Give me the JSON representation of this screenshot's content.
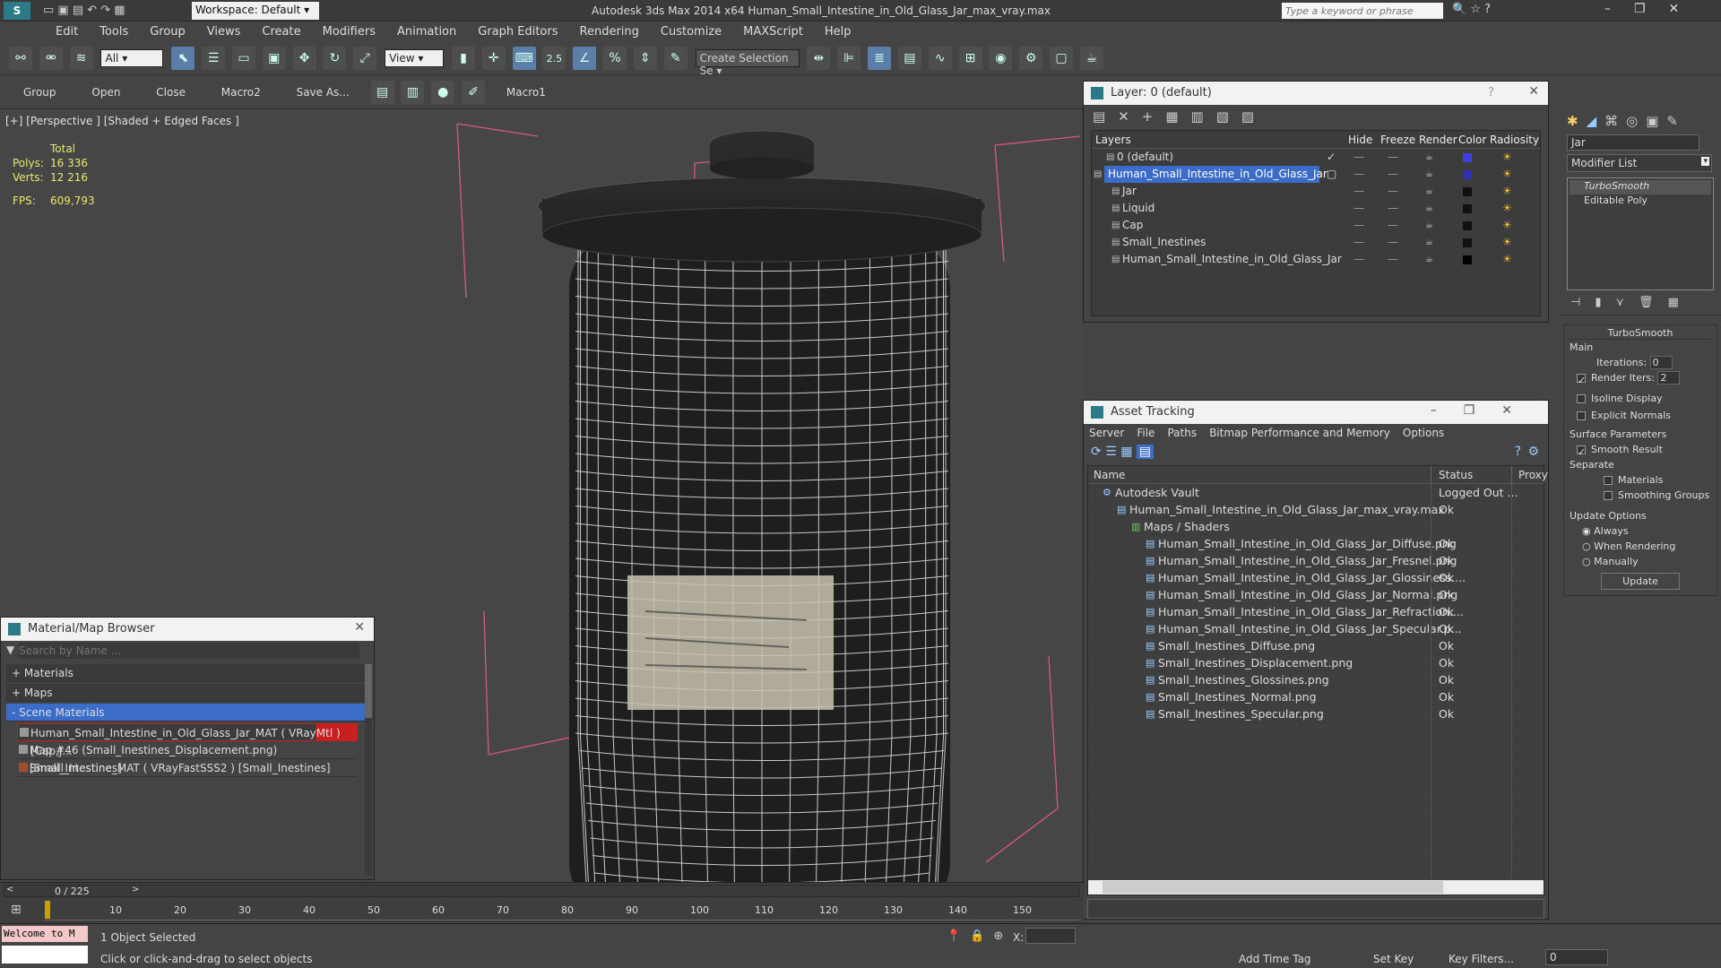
{
  "title_bar": {
    "workspace": "Workspace: Default",
    "app_title": "Autodesk 3ds Max  2014 x64     Human_Small_Intestine_in_Old_Glass_Jar_max_vray.max",
    "search_placeholder": "Type a keyword or phrase"
  },
  "menu": [
    "Edit",
    "Tools",
    "Group",
    "Views",
    "Create",
    "Modifiers",
    "Animation",
    "Graph Editors",
    "Rendering",
    "Customize",
    "MAXScript",
    "Help"
  ],
  "toolbar": {
    "filter": "All",
    "ref_coord": "View",
    "snap": "2.5",
    "selection_set": "Create Selection Se"
  },
  "ribbon": [
    "Group",
    "Open",
    "Close",
    "Macro2",
    "Save As...",
    "Macro1"
  ],
  "viewport": {
    "label": "[+] [Perspective ] [Shaded + Edged Faces ]",
    "stats_header": "Total",
    "polys_label": "Polys:",
    "polys": "16 336",
    "verts_label": "Verts:",
    "verts": "12 216",
    "fps_label": "FPS:",
    "fps": "609,793"
  },
  "layer_panel": {
    "title": "Layer: 0 (default)",
    "columns": [
      "Layers",
      "Hide",
      "Freeze",
      "Render",
      "Color",
      "Radiosity"
    ],
    "rows": [
      {
        "name": "0 (default)",
        "color": "#4040e0"
      },
      {
        "name": "Human_Small_Intestine_in_Old_Glass_Jar",
        "color": "#3030b0",
        "selected": true
      },
      {
        "name": "Jar",
        "color": "#111111"
      },
      {
        "name": "Liquid",
        "color": "#111111"
      },
      {
        "name": "Cap",
        "color": "#111111"
      },
      {
        "name": "Small_Inestines",
        "color": "#111111"
      },
      {
        "name": "Human_Small_Intestine_in_Old_Glass_Jar",
        "color": "#000000"
      }
    ]
  },
  "asset_tracking": {
    "title": "Asset Tracking",
    "menu": [
      "Server",
      "File",
      "Paths",
      "Bitmap Performance and Memory",
      "Options"
    ],
    "columns": [
      "Name",
      "Status",
      "Proxy"
    ],
    "rows": [
      {
        "name": "Autodesk Vault",
        "status": "Logged Out ...",
        "indent": 1
      },
      {
        "name": "Human_Small_Intestine_in_Old_Glass_Jar_max_vray.max",
        "status": "Ok",
        "indent": 2
      },
      {
        "name": "Maps / Shaders",
        "status": "",
        "indent": 3
      },
      {
        "name": "Human_Small_Intestine_in_Old_Glass_Jar_Diffuse.png",
        "status": "Ok",
        "indent": 4
      },
      {
        "name": "Human_Small_Intestine_in_Old_Glass_Jar_Fresnel.png",
        "status": "Ok",
        "indent": 4
      },
      {
        "name": "Human_Small_Intestine_in_Old_Glass_Jar_Glossiness....",
        "status": "Ok",
        "indent": 4
      },
      {
        "name": "Human_Small_Intestine_in_Old_Glass_Jar_Normal.png",
        "status": "Ok",
        "indent": 4
      },
      {
        "name": "Human_Small_Intestine_in_Old_Glass_Jar_Refraction....",
        "status": "Ok",
        "indent": 4
      },
      {
        "name": "Human_Small_Intestine_in_Old_Glass_Jar_Specular.p...",
        "status": "Ok",
        "indent": 4
      },
      {
        "name": "Small_Inestines_Diffuse.png",
        "status": "Ok",
        "indent": 4
      },
      {
        "name": "Small_Inestines_Displacement.png",
        "status": "Ok",
        "indent": 4
      },
      {
        "name": "Small_Inestines_Glossines.png",
        "status": "Ok",
        "indent": 4
      },
      {
        "name": "Small_Inestines_Normal.png",
        "status": "Ok",
        "indent": 4
      },
      {
        "name": "Small_Inestines_Specular.png",
        "status": "Ok",
        "indent": 4
      }
    ]
  },
  "material_browser": {
    "title": "Material/Map Browser",
    "search_placeholder": "Search by Name ...",
    "groups": [
      "+ Materials",
      "+ Maps",
      "- Scene Materials"
    ],
    "items": [
      {
        "name": "Human_Small_Intestine_in_Old_Glass_Jar_MAT ( VRayMtl ) [Cap,J...",
        "highlight": true
      },
      {
        "name": "Map #46 (Small_Inestines_Displacement.png) [Small_Inestines]",
        "highlight": false
      },
      {
        "name": "Small_Intestine_MAT ( VRayFastSSS2 ) [Small_Inestines]",
        "highlight": false
      }
    ]
  },
  "command_panel": {
    "object_name": "Jar",
    "modifier_list": "Modifier List",
    "stack": [
      "TurboSmooth",
      "Editable Poly"
    ],
    "rollout_title": "TurboSmooth",
    "main_label": "Main",
    "iterations_label": "Iterations:",
    "iterations": "0",
    "render_iters_label": "Render Iters:",
    "render_iters": "2",
    "isoline": "Isoline Display",
    "explicit_normals": "Explicit Normals",
    "surface_params": "Surface Parameters",
    "smooth_result": "Smooth Result",
    "separate": "Separate",
    "materials": "Materials",
    "smoothing_groups": "Smoothing Groups",
    "update_options": "Update Options",
    "always": "Always",
    "when_rendering": "When Rendering",
    "manually": "Manually",
    "update_button": "Update"
  },
  "timeline": {
    "frame_display": "0 / 225",
    "ticks": [
      "10",
      "20",
      "30",
      "40",
      "50",
      "60",
      "70",
      "80",
      "90",
      "100",
      "110",
      "120",
      "130",
      "140",
      "150"
    ]
  },
  "status": {
    "maxscript": "Welcome to M",
    "selected": "1 Object Selected",
    "prompt": "Click or click-and-drag to select objects",
    "x_label": "X:",
    "add_time_tag": "Add Time Tag",
    "set_key": "Set Key",
    "key_filters": "Key Filters...",
    "frame": "0"
  }
}
